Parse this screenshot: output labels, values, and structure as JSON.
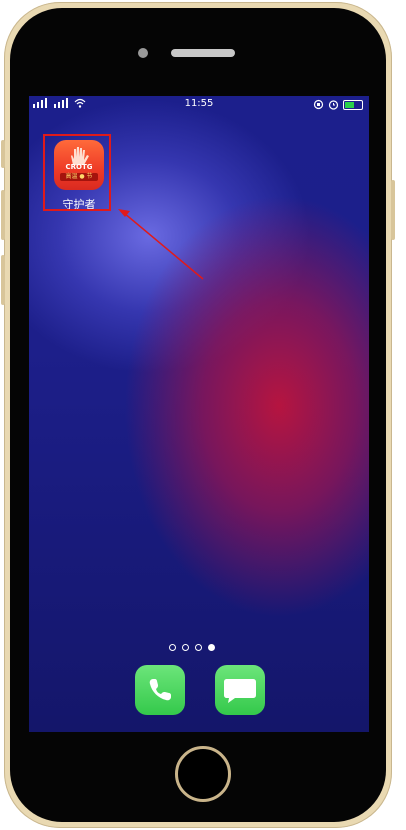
{
  "status_bar": {
    "time": "11:55"
  },
  "apps": [
    {
      "label": "守护者",
      "icon_text": "CROTG",
      "icon_badge": "高温 ● 节",
      "icon": "hand-icon"
    }
  ],
  "dock": [
    {
      "name": "phone-app",
      "icon": "phone-icon"
    },
    {
      "name": "messages-app",
      "icon": "message-icon"
    }
  ],
  "page_indicator": {
    "count": 4,
    "active": 4
  },
  "colors": {
    "highlight": "#e01a1a",
    "dock_green": "#3fd158",
    "app_red": "#ee3b27",
    "phone_frame": "#e9d9b2"
  }
}
